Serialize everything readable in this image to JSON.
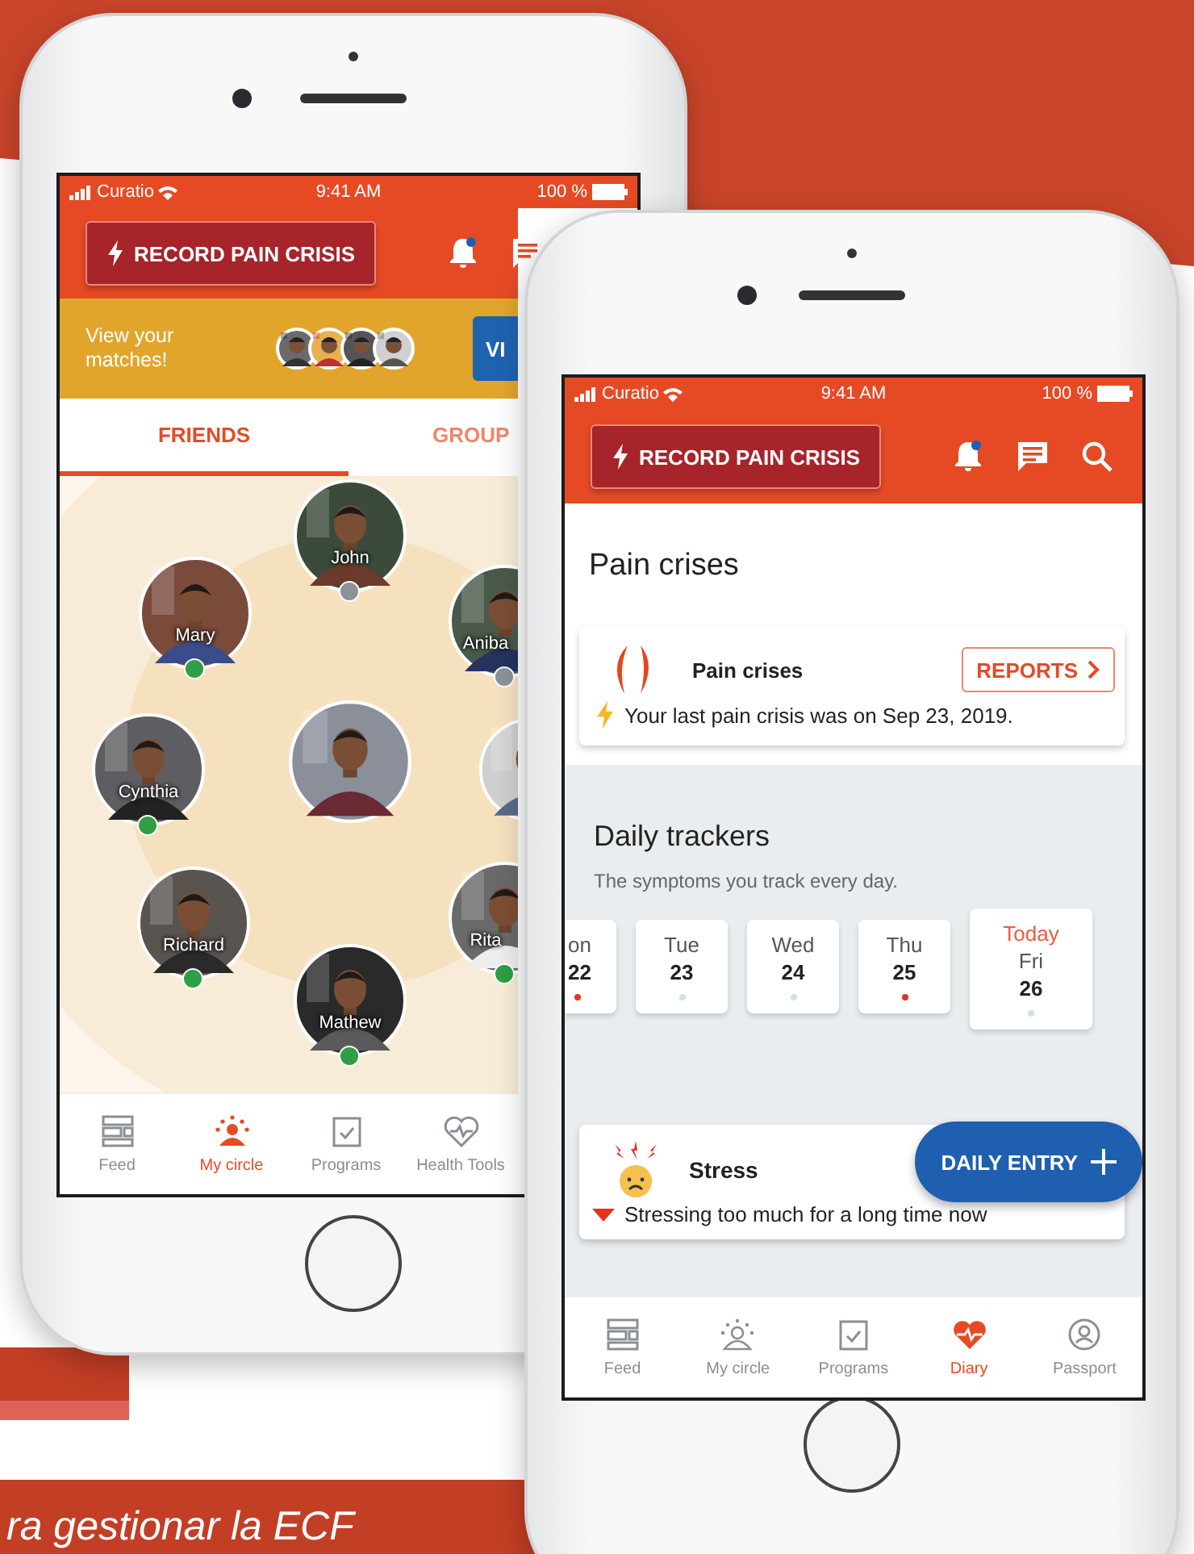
{
  "backdrop": {
    "caption": "ra gestionar la ECF"
  },
  "left_phone": {
    "status_bar": {
      "carrier": "Curatio",
      "time": "9:41 AM",
      "battery": "100 %"
    },
    "record_button": "RECORD PAIN CRISIS",
    "has_notification": true,
    "banner": {
      "text": "View your matches!",
      "button": "VI"
    },
    "tabs": [
      {
        "label": "FRIENDS",
        "selected": true
      },
      {
        "label": "GROUP",
        "selected": false
      }
    ],
    "circle": [
      {
        "kind": "member",
        "name": "John",
        "online": false
      },
      {
        "kind": "member",
        "name": "Mary",
        "online": true
      },
      {
        "kind": "member",
        "name": "Aniba",
        "online": false
      },
      {
        "kind": "member",
        "name": "Cynthia",
        "online": true
      },
      {
        "kind": "me"
      },
      {
        "kind": "edge"
      },
      {
        "kind": "member",
        "name": "Richard",
        "online": true
      },
      {
        "kind": "member",
        "name": "Rita",
        "online": true
      },
      {
        "kind": "member",
        "name": "Mathew",
        "online": true
      }
    ],
    "nav": [
      {
        "kind": "feed",
        "label": "Feed",
        "selected": false
      },
      {
        "kind": "circle",
        "label": "My circle",
        "selected": true
      },
      {
        "kind": "programs",
        "label": "Programs",
        "selected": false
      },
      {
        "kind": "health",
        "label": "Health Tools",
        "selected": false
      }
    ]
  },
  "right_phone": {
    "status_bar": {
      "carrier": "Curatio",
      "time": "9:41 AM",
      "battery": "100 %"
    },
    "record_button": "RECORD PAIN CRISIS",
    "has_notification": true,
    "pain_section": {
      "title": "Pain crises",
      "card_title": "Pain crises",
      "button": "REPORTS",
      "note": "Your last pain crisis was on Sep 23, 2019."
    },
    "trackers": {
      "title": "Daily trackers",
      "subtitle": "The symptoms you track every day.",
      "days": [
        {
          "day": "on",
          "date": "22",
          "logged": true,
          "selected": false
        },
        {
          "day": "Tue",
          "date": "23",
          "logged": false,
          "selected": false
        },
        {
          "day": "Wed",
          "date": "24",
          "logged": false,
          "selected": false
        },
        {
          "day": "Thu",
          "date": "25",
          "logged": true,
          "selected": false
        },
        {
          "day": "Fri",
          "date": "26",
          "logged": false,
          "selected": true,
          "today_label": "Today"
        }
      ]
    },
    "stress": {
      "title": "Stress",
      "note": "Stressing too much for a long time now",
      "worsening": true
    },
    "fab": "DAILY ENTRY",
    "nav": [
      {
        "kind": "feed",
        "label": "Feed",
        "selected": false
      },
      {
        "kind": "circle",
        "label": "My circle",
        "selected": false
      },
      {
        "kind": "programs",
        "label": "Programs",
        "selected": false
      },
      {
        "kind": "diary",
        "label": "Diary",
        "selected": true
      },
      {
        "kind": "passport",
        "label": "Passport",
        "selected": false
      }
    ]
  }
}
